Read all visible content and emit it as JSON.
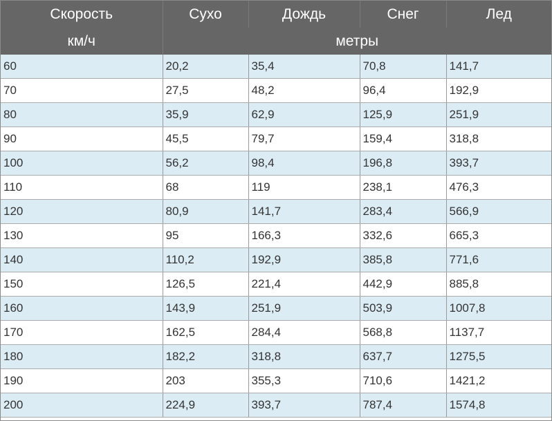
{
  "header": {
    "row1": [
      "Скорость",
      "Сухо",
      "Дождь",
      "Снег",
      "Лед"
    ],
    "unit_speed": "км/ч",
    "unit_distance": "метры"
  },
  "rows": [
    [
      "60",
      "20,2",
      "35,4",
      "70,8",
      "141,7"
    ],
    [
      "70",
      "27,5",
      "48,2",
      "96,4",
      "192,9"
    ],
    [
      "80",
      "35,9",
      "62,9",
      "125,9",
      "251,9"
    ],
    [
      "90",
      "45,5",
      "79,7",
      "159,4",
      "318,8"
    ],
    [
      "100",
      "56,2",
      "98,4",
      "196,8",
      "393,7"
    ],
    [
      "110",
      "68",
      "119",
      "238,1",
      "476,3"
    ],
    [
      "120",
      "80,9",
      "141,7",
      "283,4",
      "566,9"
    ],
    [
      "130",
      "95",
      "166,3",
      "332,6",
      "665,3"
    ],
    [
      "140",
      "110,2",
      "192,9",
      "385,8",
      "771,6"
    ],
    [
      "150",
      "126,5",
      "221,4",
      "442,9",
      "885,8"
    ],
    [
      "160",
      "143,9",
      "251,9",
      "503,9",
      "1007,8"
    ],
    [
      "170",
      "162,5",
      "284,4",
      "568,8",
      "1137,7"
    ],
    [
      "180",
      "182,2",
      "318,8",
      "637,7",
      "1275,5"
    ],
    [
      "190",
      "203",
      "355,3",
      "710,6",
      "1421,2"
    ],
    [
      "200",
      "224,9",
      "393,7",
      "787,4",
      "1574,8"
    ]
  ],
  "colors": {
    "header_bg": "#666666",
    "row_alt": "#dcecf4",
    "row_base": "#ffffff"
  }
}
